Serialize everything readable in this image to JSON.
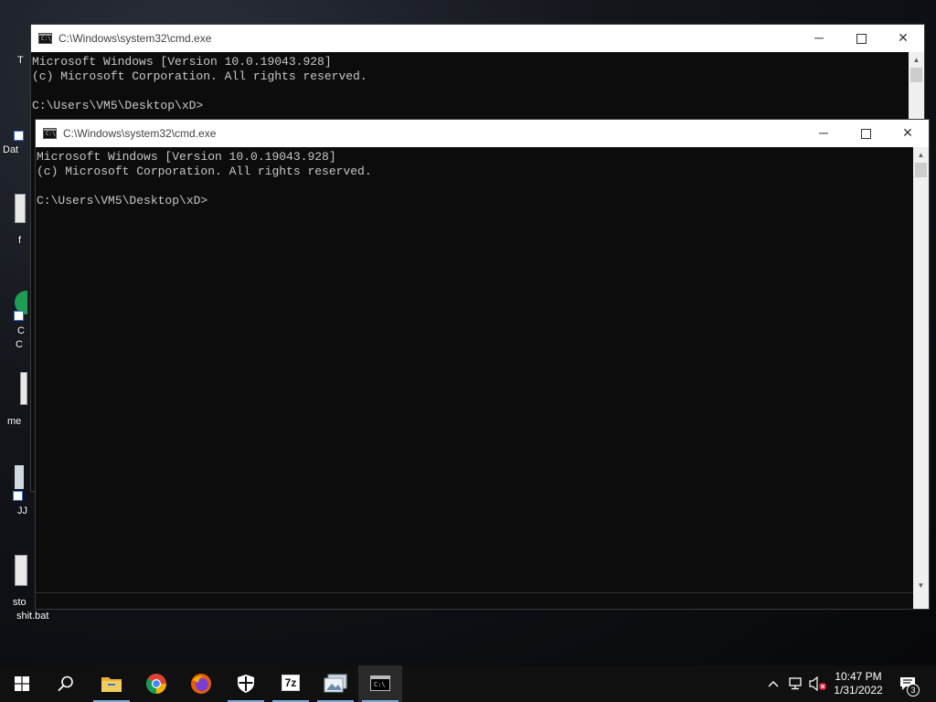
{
  "desktop": {
    "icons": [
      {
        "label": "T"
      },
      {
        "label": "Dat"
      },
      {
        "label": "f"
      },
      {
        "label": "C"
      },
      {
        "label": "C"
      },
      {
        "label": "me"
      },
      {
        "label": "JJ"
      },
      {
        "label": "sto"
      },
      {
        "label": "shit.bat"
      }
    ]
  },
  "windows": [
    {
      "title": "C:\\Windows\\system32\\cmd.exe",
      "lines": [
        "Microsoft Windows [Version 10.0.19043.928]",
        "(c) Microsoft Corporation. All rights reserved.",
        "",
        "C:\\Users\\VM5\\Desktop\\xD>"
      ]
    },
    {
      "title": "C:\\Windows\\system32\\cmd.exe",
      "lines": [
        "Microsoft Windows [Version 10.0.19043.928]",
        "(c) Microsoft Corporation. All rights reserved.",
        "",
        "C:\\Users\\VM5\\Desktop\\xD>"
      ]
    }
  ],
  "window_controls": {
    "minimize": "─",
    "close": "✕",
    "scroll_up": "▲",
    "scroll_down": "▼"
  },
  "taskbar": {
    "items": [
      {
        "icon": "windows-start-icon"
      },
      {
        "icon": "search-icon"
      },
      {
        "icon": "file-explorer-icon"
      },
      {
        "icon": "chrome-icon"
      },
      {
        "icon": "firefox-icon"
      },
      {
        "icon": "windows-security-icon"
      },
      {
        "icon": "7zip-icon",
        "label": "7z"
      },
      {
        "icon": "photos-icon"
      },
      {
        "icon": "cmd-icon",
        "active": true
      }
    ],
    "tray": {
      "time": "10:47 PM",
      "date": "1/31/2022",
      "notification_count": "3"
    }
  },
  "colors": {
    "console_bg": "#0c0c0c",
    "console_text": "#c7c7c7",
    "taskbar_bg": "#101010",
    "active_underline": "#7aa7d8"
  }
}
